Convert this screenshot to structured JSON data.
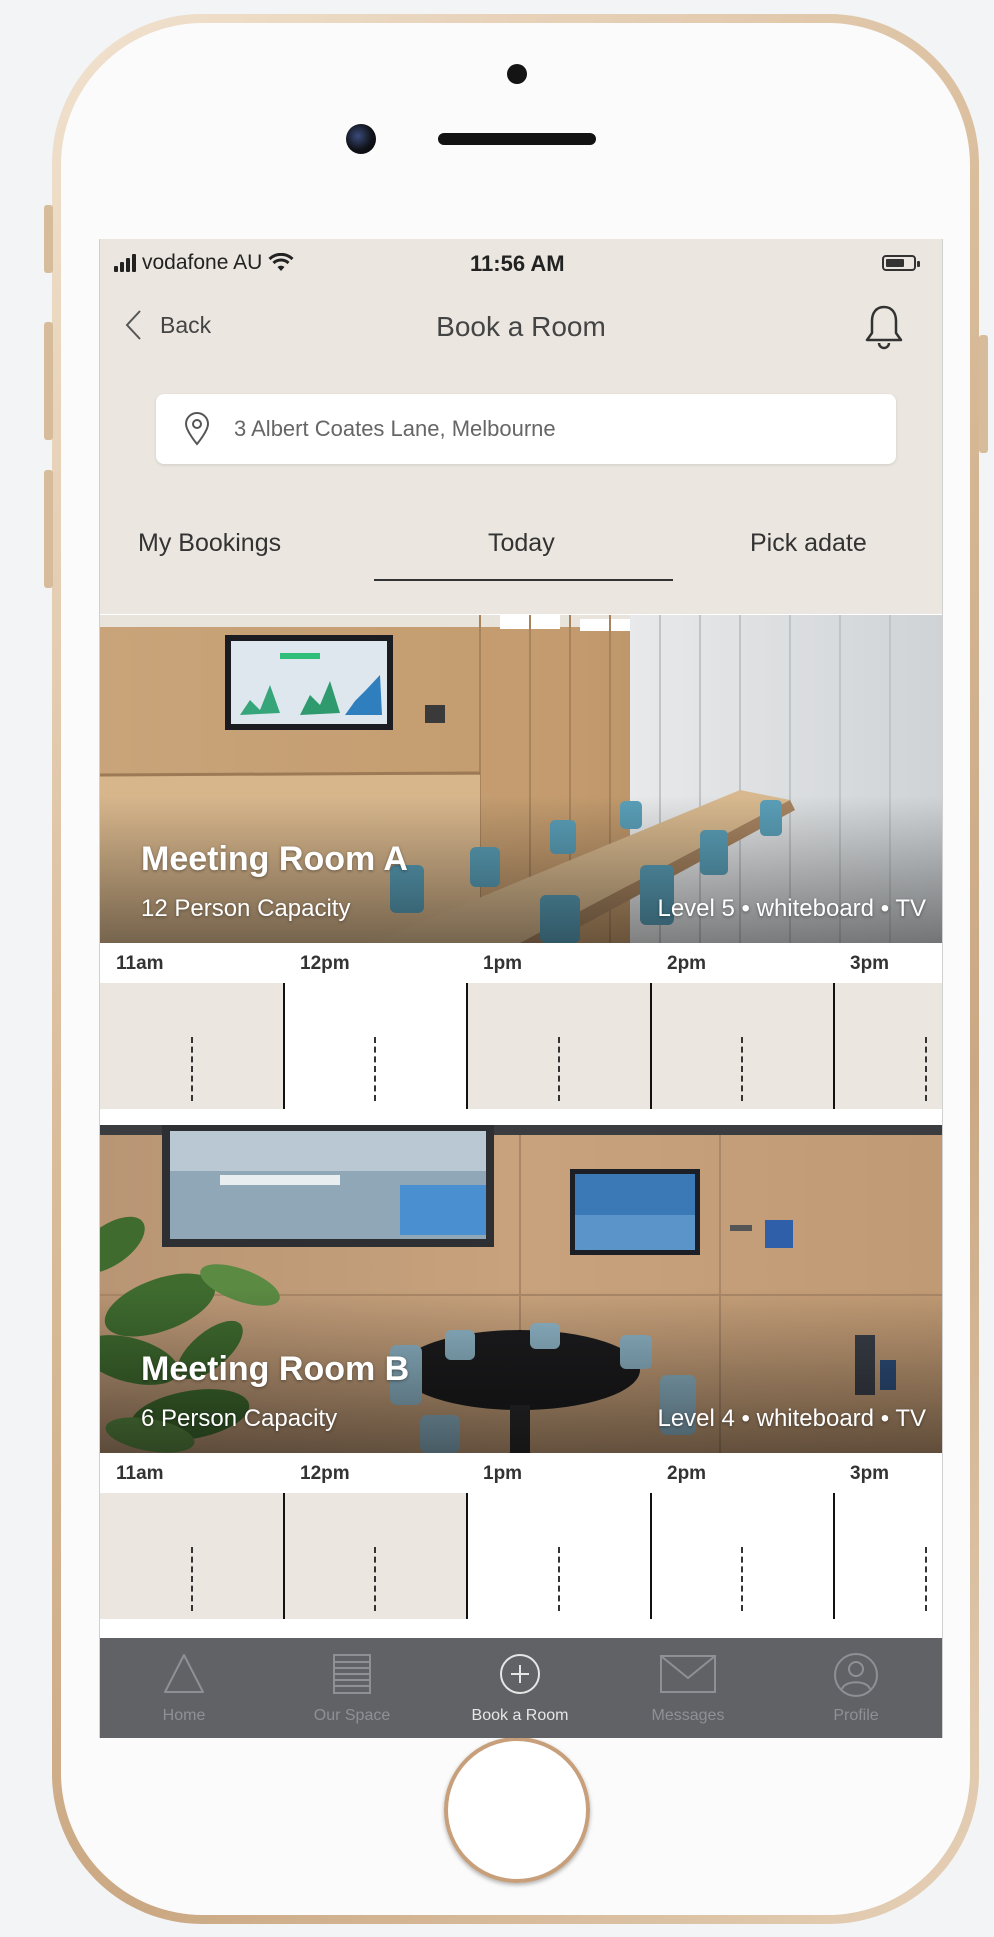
{
  "status_bar": {
    "carrier": "vodafone AU",
    "time": "11:56 AM"
  },
  "nav": {
    "back_label": "Back",
    "title": "Book a Room"
  },
  "search": {
    "value": "3 Albert Coates Lane, Melbourne"
  },
  "tabs": [
    {
      "label": "My Bookings",
      "active": false
    },
    {
      "label": "Today",
      "active": true
    },
    {
      "label": "Pick adate",
      "active": false
    }
  ],
  "rooms": [
    {
      "name": "Meeting Room A",
      "capacity": "12 Person Capacity",
      "meta": "Level 5 • whiteboard • TV",
      "hours": [
        "11am",
        "12pm",
        "1pm",
        "2pm",
        "3pm"
      ],
      "slots": [
        "booked",
        "available",
        "booked",
        "booked",
        "booked"
      ]
    },
    {
      "name": "Meeting Room B",
      "capacity": "6 Person Capacity",
      "meta": "Level 4 • whiteboard • TV",
      "hours": [
        "11am",
        "12pm",
        "1pm",
        "2pm",
        "3pm"
      ],
      "slots": [
        "booked",
        "booked",
        "available",
        "available",
        "available"
      ]
    }
  ],
  "tabbar": [
    {
      "label": "Home",
      "icon": "triangle-home-icon",
      "active": false
    },
    {
      "label": "Our Space",
      "icon": "grid-lines-icon",
      "active": false
    },
    {
      "label": "Book a Room",
      "icon": "plus-circle-icon",
      "active": true
    },
    {
      "label": "Messages",
      "icon": "envelope-icon",
      "active": false
    },
    {
      "label": "Profile",
      "icon": "user-circle-icon",
      "active": false
    }
  ],
  "colors": {
    "header_bg": "#ebe7e0",
    "booked_slot": "#ebe7e0",
    "available_slot": "#ffffff",
    "tabbar_bg": "#606266",
    "phone_gold": "#d9bc9a"
  }
}
